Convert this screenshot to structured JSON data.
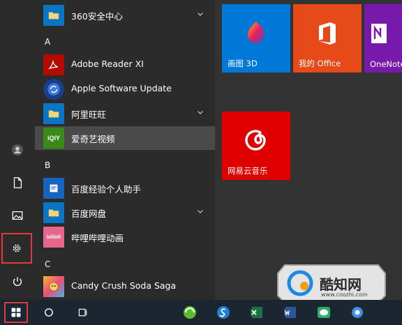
{
  "app_list": {
    "items": [
      {
        "kind": "app",
        "label": "360安全中心",
        "icon": "folder-icon",
        "chevron": true
      },
      {
        "kind": "letter",
        "label": "A"
      },
      {
        "kind": "app",
        "label": "Adobe Reader XI",
        "icon": "adobe-reader-icon"
      },
      {
        "kind": "app",
        "label": "Apple Software Update",
        "icon": "apple-update-icon"
      },
      {
        "kind": "app",
        "label": "阿里旺旺",
        "icon": "folder-icon",
        "chevron": true
      },
      {
        "kind": "app",
        "label": "爱奇艺视频",
        "icon": "iqiyi-icon",
        "badge": "iQIY",
        "hover": true
      },
      {
        "kind": "letter",
        "label": "B"
      },
      {
        "kind": "app",
        "label": "百度经验个人助手",
        "icon": "baidu-jingyan-icon"
      },
      {
        "kind": "app",
        "label": "百度网盘",
        "icon": "folder-icon",
        "chevron": true
      },
      {
        "kind": "app",
        "label": "哔哩哔哩动画",
        "icon": "bilibili-icon",
        "badge": "bilibili"
      },
      {
        "kind": "letter",
        "label": "C"
      },
      {
        "kind": "app",
        "label": "Candy Crush Soda Saga",
        "icon": "candy-crush-icon"
      }
    ]
  },
  "tiles": [
    {
      "label": "画图 3D",
      "icon": "paint3d-icon",
      "color": "#0078d7"
    },
    {
      "label": "我的 Office",
      "icon": "office-icon",
      "color": "#e64a19"
    },
    {
      "label": "OneNote",
      "icon": "onenote-icon",
      "color": "#7719aa"
    },
    {
      "label": "网易云音乐",
      "icon": "netease-music-icon",
      "color": "#e00000"
    }
  ],
  "watermark": {
    "name": "酷知网",
    "url": "www.coozhi.com"
  },
  "colors": {
    "highlight": "#e03a3a",
    "taskbar": "#1c2630",
    "list_bg": "#2b2b2b"
  }
}
